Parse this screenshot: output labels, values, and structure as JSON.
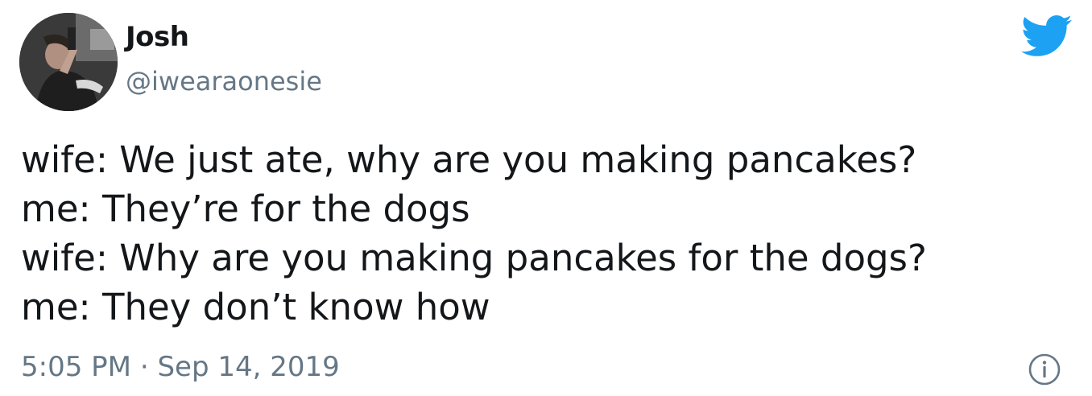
{
  "tweet": {
    "author": {
      "display_name": "Josh",
      "handle": "@iwearaonesie",
      "avatar_icon": "user-avatar"
    },
    "lines": [
      "wife: We just ate, why are you making pancakes?",
      "me: They’re for the dogs",
      "wife: Why are you making pancakes for the dogs?",
      "me: They don’t know how"
    ],
    "time": "5:05 PM",
    "separator": "·",
    "date": "Sep 14, 2019",
    "icons": {
      "brand": "twitter-bird-icon",
      "info": "info-icon"
    },
    "colors": {
      "brand": "#1DA1F2",
      "text": "#14171A",
      "secondary": "#657786"
    }
  }
}
